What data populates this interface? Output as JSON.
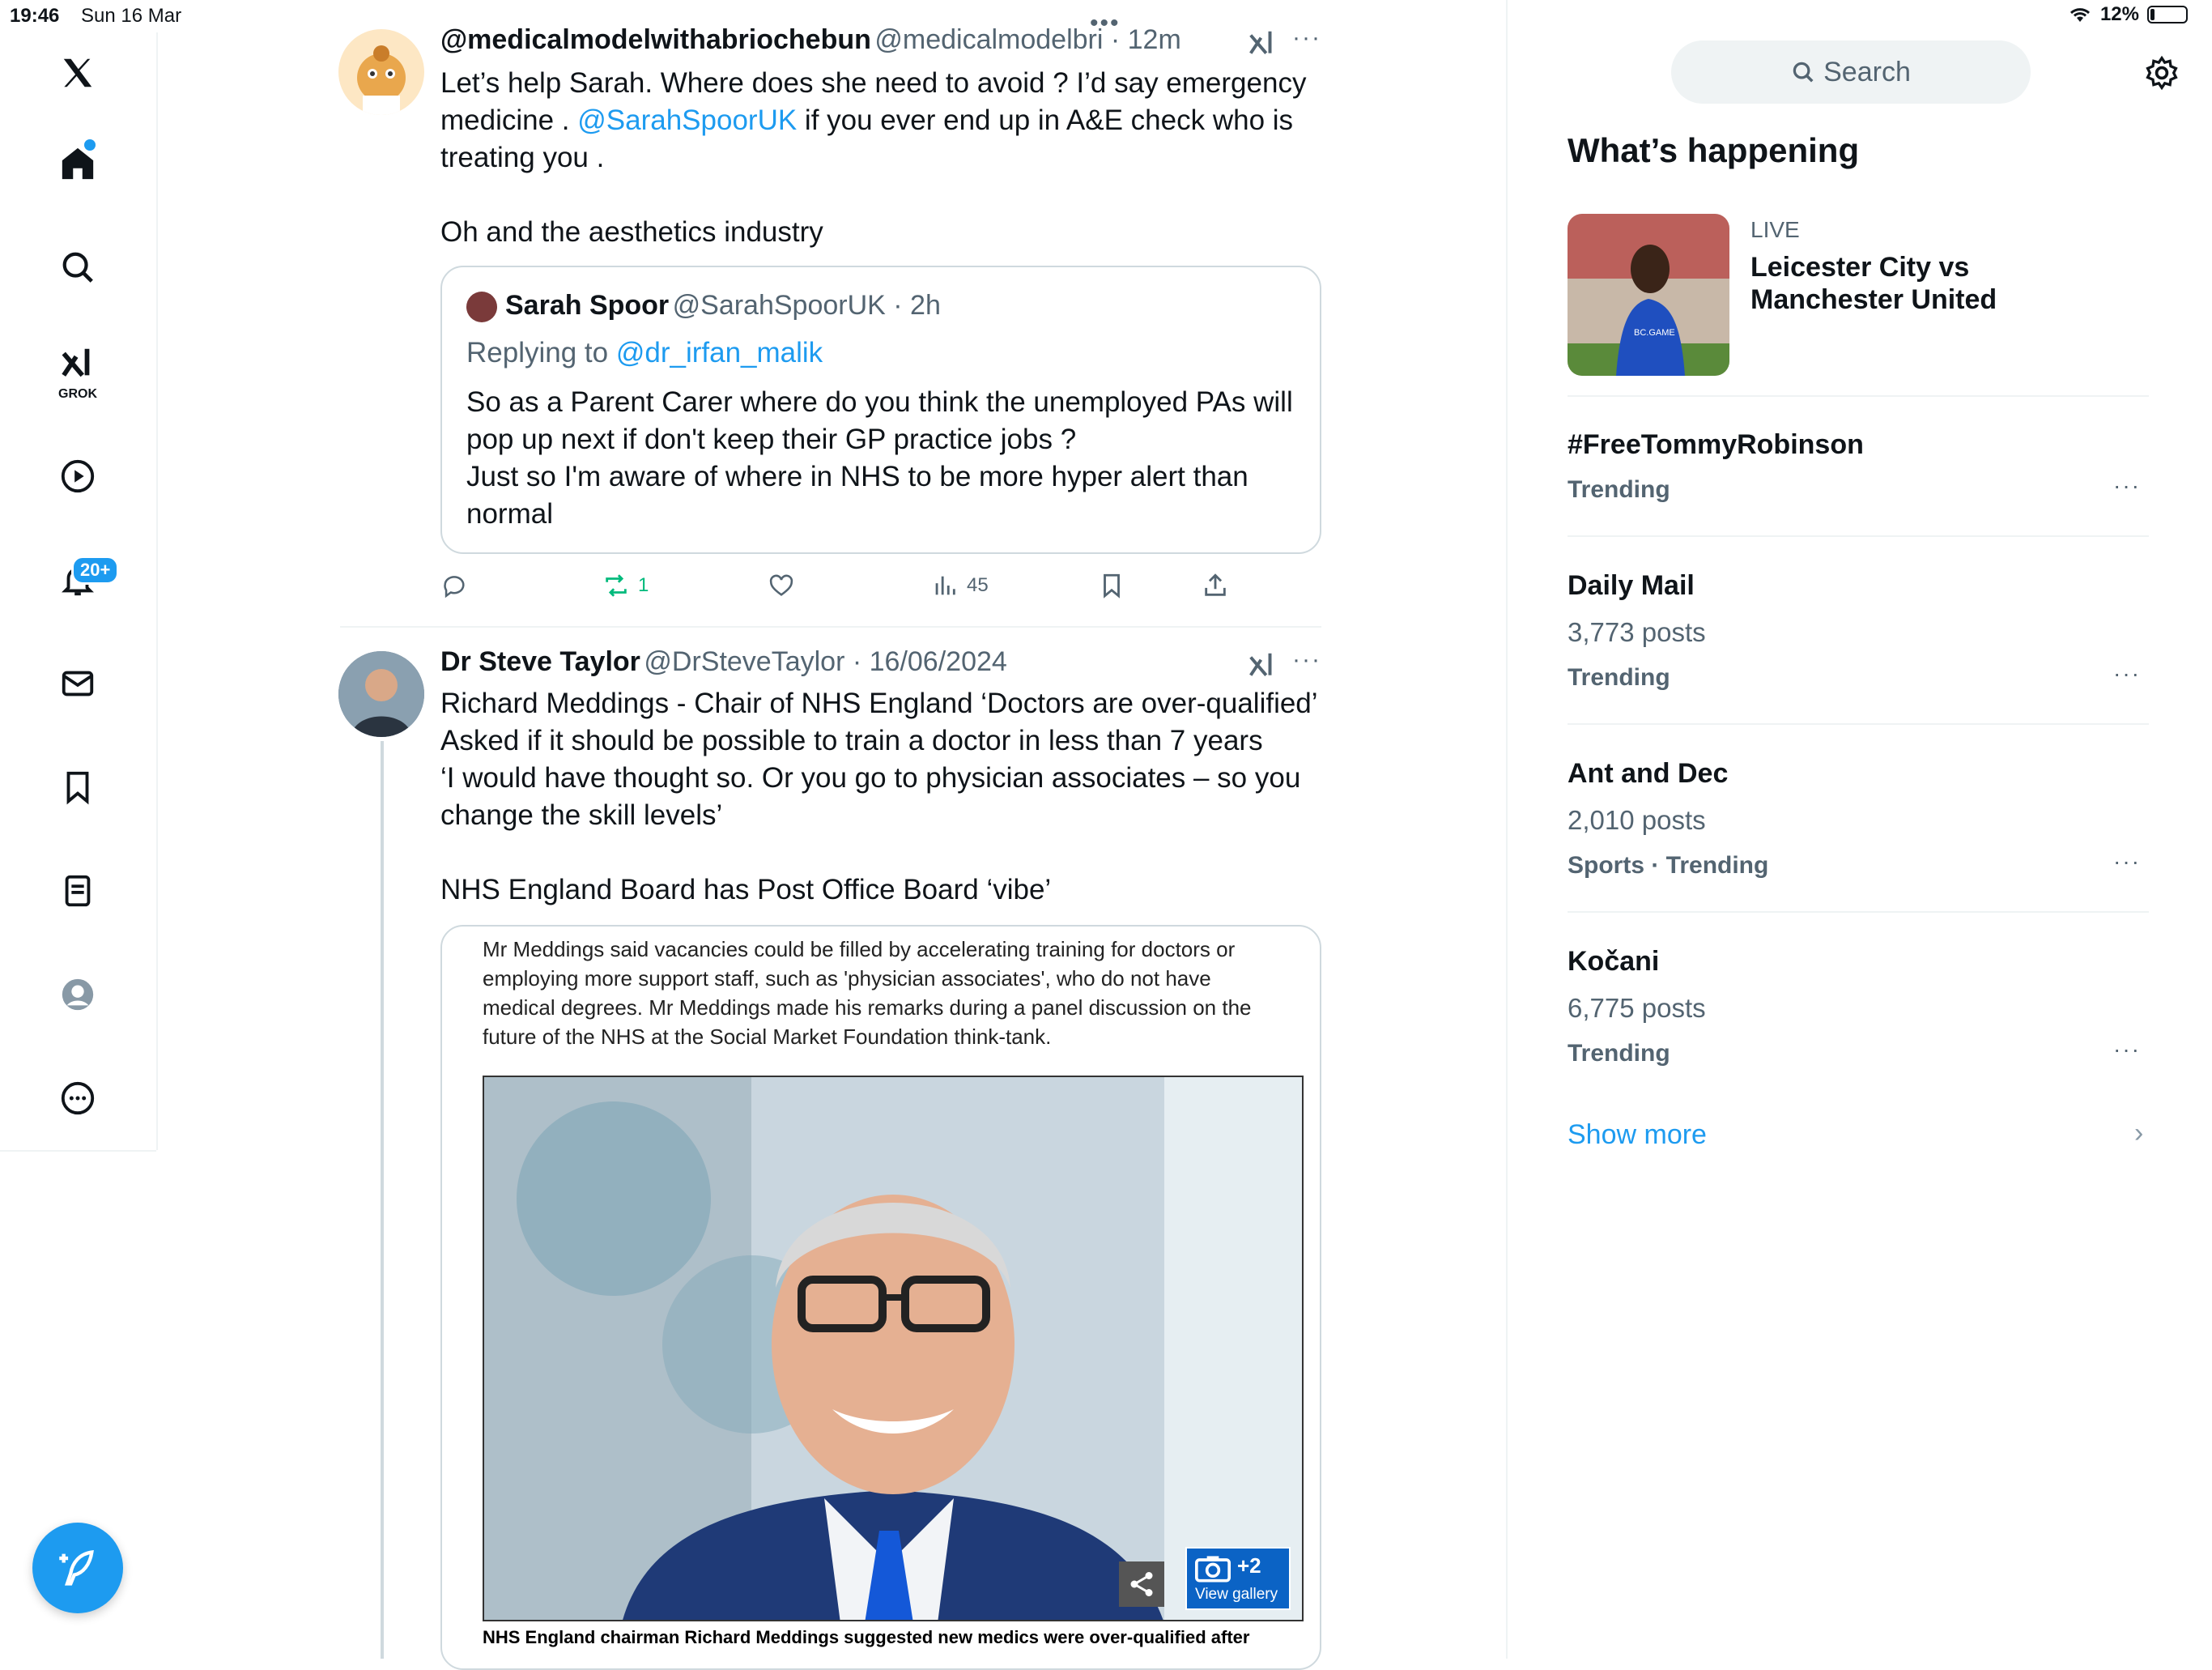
{
  "status_bar": {
    "time": "19:46",
    "date": "Sun 16 Mar",
    "battery": "12%",
    "battery_level": 0.12
  },
  "nav": {
    "grok_label": "GROK",
    "notifications_badge": "20+"
  },
  "tweets": [
    {
      "display_name": "@medicalmodelwithabriochebun",
      "handle": "@medicalmodelbri",
      "time": "12m",
      "text_line1": "Let’s help Sarah. Where does she need to avoid ? I’d say emergency",
      "text_line2_a": "medicine . ",
      "text_line2_mention": "@SarahSpoorUK",
      "text_line2_b": " if you ever end up in A&E check who is",
      "text_line3": "treating you .",
      "text_line4": "Oh and the aesthetics industry",
      "quote": {
        "display_name": "Sarah Spoor",
        "handle": "@SarahSpoorUK",
        "time": "2h",
        "replying_prefix": "Replying to ",
        "replying_to": "@dr_irfan_malik",
        "line1": "So as a Parent Carer where do you think the unemployed PAs will",
        "line2": "pop up next if don't keep their GP practice jobs ?",
        "line3": "Just so I'm aware of where in NHS to be more hyper alert than",
        "line4": "normal"
      },
      "actions": {
        "retweets": "1",
        "views": "45"
      }
    },
    {
      "display_name": "Dr Steve Taylor",
      "handle": "@DrSteveTaylor",
      "time": "16/06/2024",
      "line1": "Richard Meddings - Chair of NHS England ‘Doctors are over-qualified’",
      "line2": "Asked if it should be possible to train a doctor in less than 7 years",
      "line3": "‘I would have thought so. Or you go to physician associates – so you",
      "line4": "change the skill levels’",
      "line5": "NHS England Board has Post Office Board ‘vibe’",
      "card": {
        "cap1": "Mr Meddings said vacancies could be filled by accelerating training for doctors or",
        "cap2": "employing more support staff, such as 'physician associates', who do not have",
        "cap3": "medical degrees. Mr Meddings made his remarks during a panel discussion on the",
        "cap4": "future of the NHS at the Social Market Foundation think-tank.",
        "gallery_count": "+2",
        "gallery_label": "View gallery",
        "photo_caption": "NHS England chairman Richard Meddings suggested new medics were over-qualified after"
      }
    }
  ],
  "sidebar": {
    "search_placeholder": "Search",
    "title": "What’s happening",
    "live": {
      "label": "LIVE",
      "title_line1": "Leicester City vs",
      "title_line2": "Manchester United",
      "shirt_text": "BC.GAME"
    },
    "trends": [
      {
        "name": "#FreeTommyRobinson",
        "posts": "",
        "category": "Trending"
      },
      {
        "name": "Daily Mail",
        "posts": "3,773 posts",
        "category": "Trending"
      },
      {
        "name": "Ant and Dec",
        "posts": "2,010 posts",
        "category": "Sports · Trending"
      },
      {
        "name": "Kočani",
        "posts": "6,775 posts",
        "category": "Trending"
      }
    ],
    "show_more": "Show more"
  },
  "colors": {
    "accent": "#1d9bf0",
    "retweet": "#00ba7c"
  }
}
